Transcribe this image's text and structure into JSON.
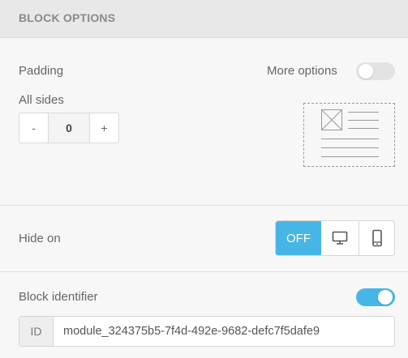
{
  "header": {
    "title": "BLOCK OPTIONS"
  },
  "padding": {
    "label": "Padding",
    "more_options_label": "More options",
    "more_options_on": false,
    "all_sides_label": "All sides",
    "stepper": {
      "minus": "-",
      "value": "0",
      "plus": "+"
    }
  },
  "hide_on": {
    "label": "Hide on",
    "off_label": "OFF",
    "options": [
      {
        "label": "OFF",
        "icon": "off-text",
        "selected": true
      },
      {
        "label": "",
        "icon": "desktop-icon",
        "selected": false
      },
      {
        "label": "",
        "icon": "mobile-icon",
        "selected": false
      }
    ]
  },
  "block_identifier": {
    "label": "Block identifier",
    "enabled": true,
    "prefix": "ID",
    "value": "module_324375b5-7f4d-492e-9682-defc7f5dafe9"
  },
  "colors": {
    "accent": "#47b6e6",
    "header_bg": "#e8e8e8",
    "panel_bg": "#f7f7f7"
  }
}
